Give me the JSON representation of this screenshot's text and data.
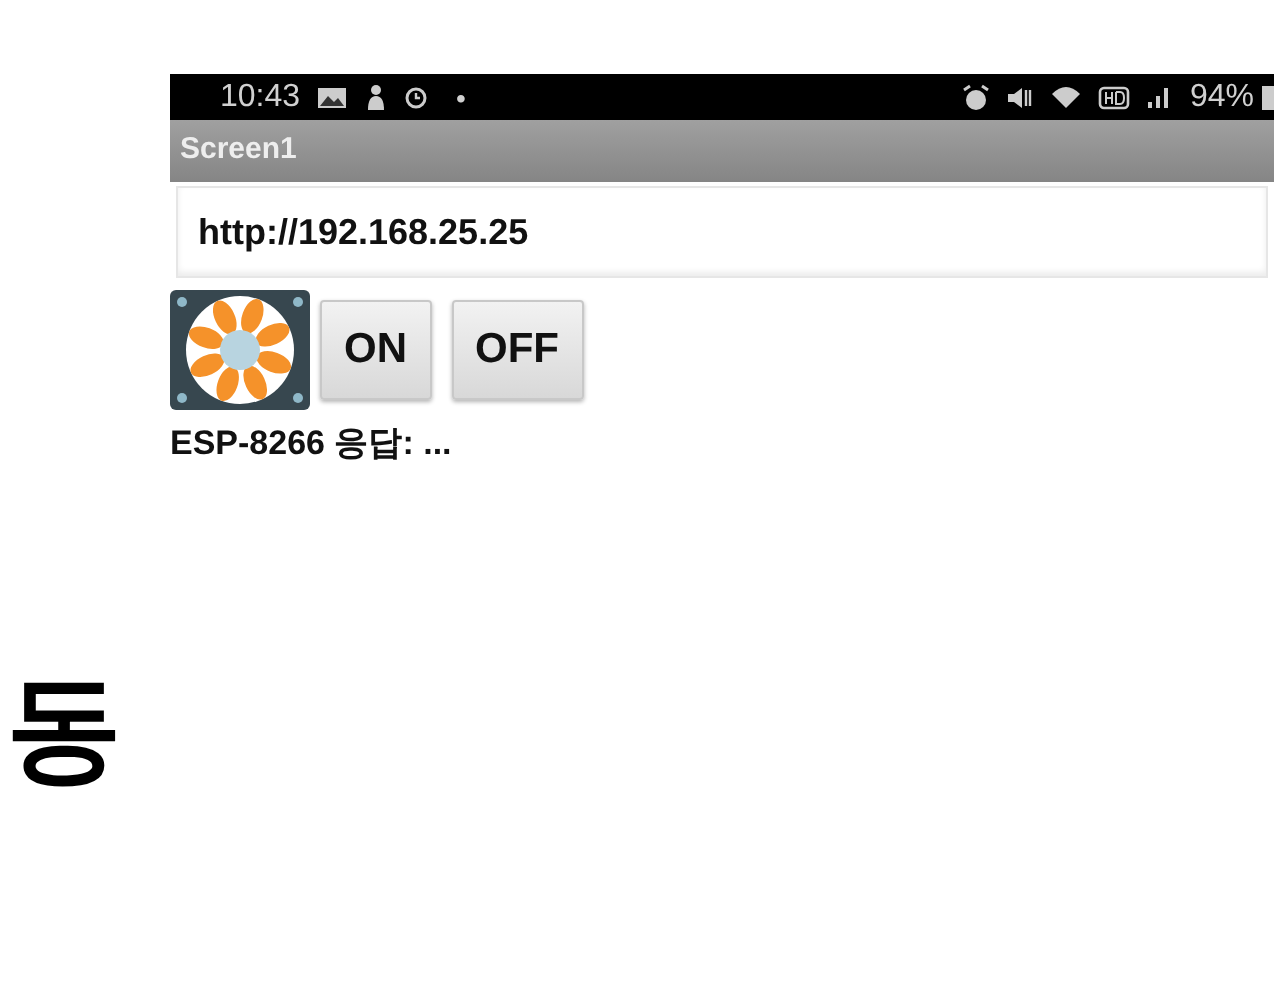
{
  "status_bar": {
    "time": "10:43",
    "dot": "•",
    "battery": "94%"
  },
  "title_bar": {
    "title": "Screen1"
  },
  "url_field": {
    "value": "http://192.168.25.25"
  },
  "buttons": [
    {
      "label": "ON"
    },
    {
      "label": "OFF"
    }
  ],
  "response_label": "ESP-8266 응답: ...",
  "caption": "동"
}
